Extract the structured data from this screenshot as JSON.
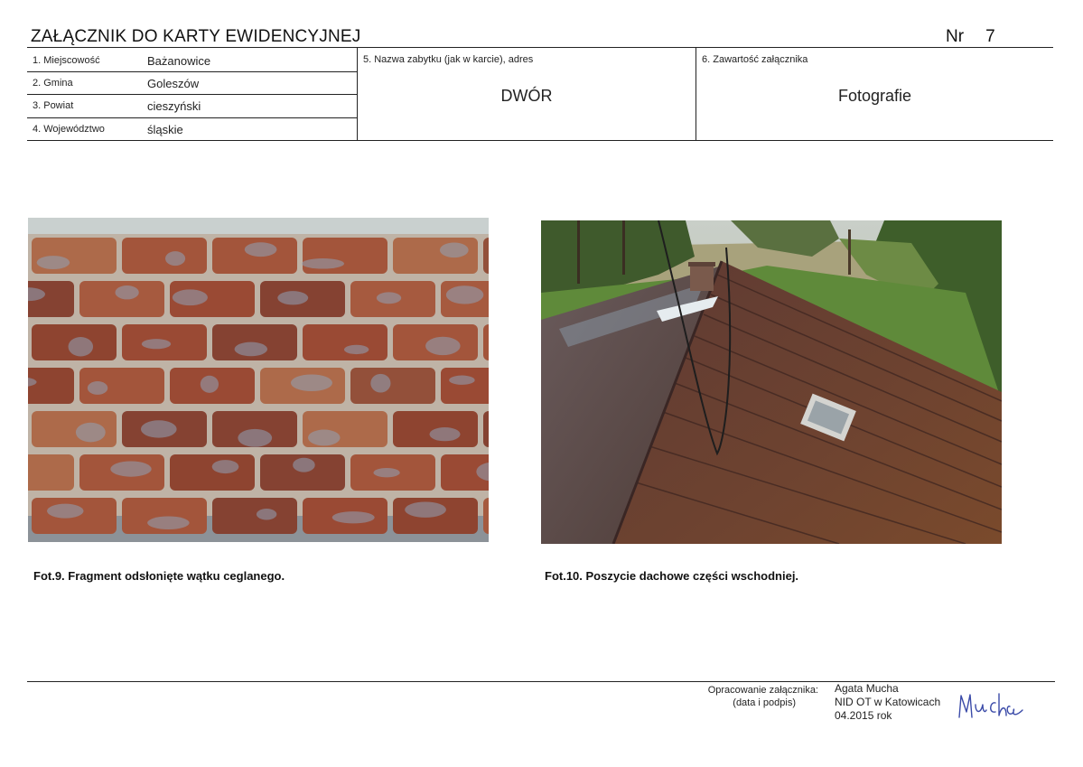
{
  "header": {
    "title": "ZAŁĄCZNIK DO KARTY EWIDENCYJNEJ",
    "nr_label": "Nr",
    "nr_value": "7"
  },
  "fields": {
    "miejscowosc_label": "1. Miejscowość",
    "miejscowosc_value": "Bażanowice",
    "gmina_label": "2. Gmina",
    "gmina_value": "Goleszów",
    "powiat_label": "3. Powiat",
    "powiat_value": "cieszyński",
    "wojewodztwo_label": "4. Województwo",
    "wojewodztwo_value": "śląskie",
    "nazwa_label": "5. Nazwa zabytku (jak w karcie), adres",
    "nazwa_value": "DWÓR",
    "zawartosc_label": "6. Zawartość załącznika",
    "zawartosc_value": "Fotografie"
  },
  "photos": [
    {
      "caption": "Fot.9. Fragment odsłonięte wątku ceglanego."
    },
    {
      "caption": "Fot.10. Poszycie dachowe części wschodniej."
    }
  ],
  "footer": {
    "opracowanie_label": "Opracowanie załącznika:",
    "data_label": "(data i podpis)",
    "author": "Agata Mucha",
    "institution": "NID OT w Katowicach",
    "date": "04.2015 rok",
    "signature": "Mucha"
  }
}
